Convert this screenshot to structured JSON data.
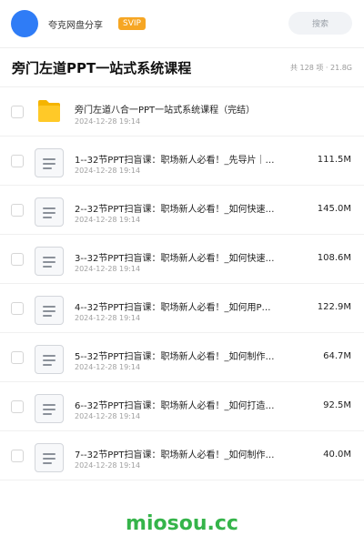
{
  "header": {
    "username": "夸克网盘分享",
    "badge": "SVIP",
    "search_placeholder": "搜索",
    "avatar_color": "#2f7cf6",
    "badge_color": "#f6a623"
  },
  "folder": {
    "title": "旁门左道PPT一站式系统课程",
    "item_count": "共 128 项",
    "total_size": "21.8G"
  },
  "files": [
    {
      "type": "folder",
      "name": "旁门左道八合一PPT一站式系统课程（完结）",
      "date": "2024-12-28 19:14",
      "size": "",
      "icon": "folder-icon"
    },
    {
      "type": "file",
      "name": "1--32节PPT扫盲课：职场新人必看！_先导片｜…",
      "date": "2024-12-28 19:14",
      "size": "111.5M",
      "icon": "document-icon"
    },
    {
      "type": "file",
      "name": "2--32节PPT扫盲课：职场新人必看！_如何快速…",
      "date": "2024-12-28 19:14",
      "size": "145.0M",
      "icon": "document-icon"
    },
    {
      "type": "file",
      "name": "3--32节PPT扫盲课：职场新人必看！_如何快速…",
      "date": "2024-12-28 19:14",
      "size": "108.6M",
      "icon": "document-icon"
    },
    {
      "type": "file",
      "name": "4--32节PPT扫盲课：职场新人必看！_如何用P…",
      "date": "2024-12-28 19:14",
      "size": "122.9M",
      "icon": "document-icon"
    },
    {
      "type": "file",
      "name": "5--32节PPT扫盲课：职场新人必看！_如何制作…",
      "date": "2024-12-28 19:14",
      "size": "64.7M",
      "icon": "document-icon"
    },
    {
      "type": "file",
      "name": "6--32节PPT扫盲课：职场新人必看！_如何打造…",
      "date": "2024-12-28 19:14",
      "size": "92.5M",
      "icon": "document-icon"
    },
    {
      "type": "file",
      "name": "7--32节PPT扫盲课：职场新人必看！_如何制作…",
      "date": "2024-12-28 19:14",
      "size": "40.0M",
      "icon": "document-icon"
    }
  ],
  "watermark": "miosou.cc",
  "watermark_color": "#35b44a"
}
